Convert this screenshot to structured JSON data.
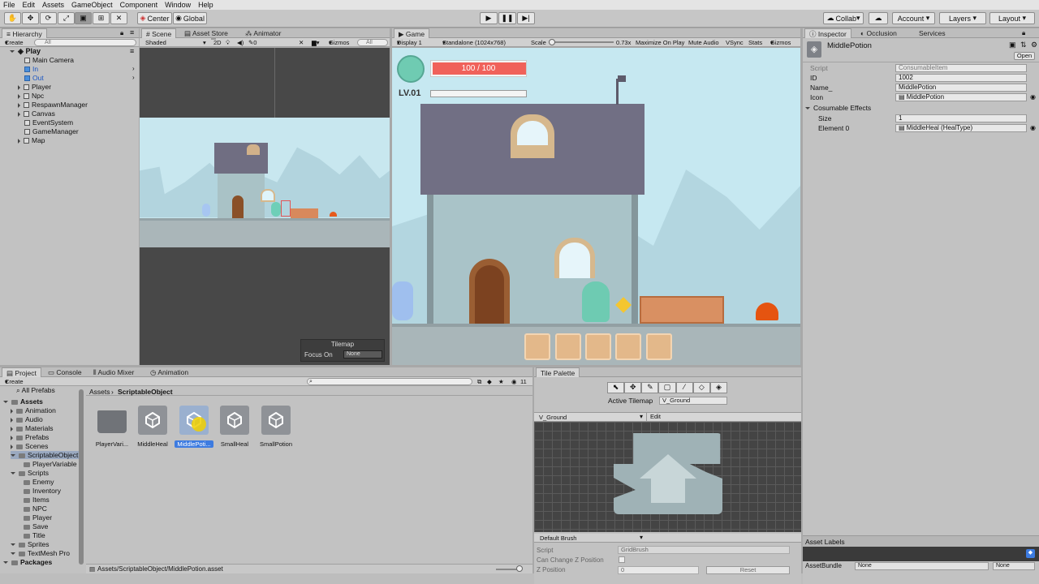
{
  "menu": [
    "File",
    "Edit",
    "Assets",
    "GameObject",
    "Component",
    "Window",
    "Help"
  ],
  "toolbar": {
    "pivot": "Center",
    "space": "Global",
    "collab": "Collab",
    "account": "Account",
    "layers": "Layers",
    "layout": "Layout"
  },
  "hierarchy": {
    "tab": "Hierarchy",
    "create": "Create",
    "search_placeholder": "All",
    "scene": "Play",
    "items": [
      "Main Camera",
      "In",
      "Out",
      "Player",
      "Npc",
      "RespawnManager",
      "Canvas",
      "EventSystem",
      "GameManager",
      "Map"
    ]
  },
  "scene_view": {
    "tabs": [
      "Scene",
      "Asset Store",
      "Animator"
    ],
    "shading": "Shaded",
    "mode_2d": "2D",
    "fx_count": "0",
    "gizmos": "Gizmos",
    "search_placeholder": "All",
    "tilemap_title": "Tilemap",
    "focus_label": "Focus On",
    "focus_value": "None"
  },
  "game_view": {
    "tab": "Game",
    "display": "Display 1",
    "resolution": "Standalone (1024x768)",
    "scale_label": "Scale",
    "scale_value": "0.73x",
    "maximize": "Maximize On Play",
    "mute": "Mute Audio",
    "vsync": "VSync",
    "stats": "Stats",
    "gizmos": "Gizmos",
    "hp_text": "100 / 100",
    "hp_fraction": 1.0,
    "level_text": "LV.01",
    "xp_fraction": 0.0
  },
  "inspector": {
    "tabs": [
      "Inspector",
      "Occlusion",
      "Services"
    ],
    "object_name": "MiddlePotion",
    "open_button": "Open",
    "fields": [
      {
        "label": "Script",
        "value": "ConsumableItem"
      },
      {
        "label": "ID",
        "value": "1002"
      },
      {
        "label": "Name_",
        "value": "MiddlePotion"
      },
      {
        "label": "Icon",
        "value": "MiddlePotion"
      }
    ],
    "section": "Cosumable Effects",
    "size_label": "Size",
    "size_value": "1",
    "element_label": "Element 0",
    "element_value": "MiddleHeal (HealType)",
    "asset_labels": "Asset Labels",
    "assetbundle_label": "AssetBundle",
    "assetbundle_value": "None",
    "assetbundle_variant": "None"
  },
  "project": {
    "tabs": [
      "Project",
      "Console",
      "Audio Mixer",
      "Animation"
    ],
    "create": "Create",
    "favorites": "All Prefabs",
    "tree": [
      {
        "label": "Assets",
        "depth": 0,
        "bold": true
      },
      {
        "label": "Animation",
        "depth": 1
      },
      {
        "label": "Audio",
        "depth": 1
      },
      {
        "label": "Materials",
        "depth": 1
      },
      {
        "label": "Prefabs",
        "depth": 1
      },
      {
        "label": "Scenes",
        "depth": 1
      },
      {
        "label": "ScriptableObject",
        "depth": 1,
        "selected": true
      },
      {
        "label": "PlayerVariable",
        "depth": 2
      },
      {
        "label": "Scripts",
        "depth": 1
      },
      {
        "label": "Enemy",
        "depth": 2
      },
      {
        "label": "Inventory",
        "depth": 2
      },
      {
        "label": "Items",
        "depth": 2
      },
      {
        "label": "NPC",
        "depth": 2
      },
      {
        "label": "Player",
        "depth": 2
      },
      {
        "label": "Save",
        "depth": 2
      },
      {
        "label": "Title",
        "depth": 2
      },
      {
        "label": "Sprites",
        "depth": 1
      },
      {
        "label": "TextMesh Pro",
        "depth": 1
      },
      {
        "label": "Packages",
        "depth": 0,
        "bold": true
      }
    ],
    "breadcrumb_root": "Assets",
    "breadcrumb_current": "ScriptableObject",
    "count": "11",
    "assets": [
      {
        "label": "PlayerVari...",
        "kind": "folder"
      },
      {
        "label": "MiddleHeal",
        "kind": "unity"
      },
      {
        "label": "MiddlePoti...",
        "kind": "unity",
        "selected": true
      },
      {
        "label": "SmallHeal",
        "kind": "unity"
      },
      {
        "label": "SmallPotion",
        "kind": "unity"
      }
    ],
    "path": "Assets/ScriptableObject/MiddlePotion.asset"
  },
  "tile_palette": {
    "tab": "Tile Palette",
    "active_label": "Active Tilemap",
    "active_value": "V_Ground",
    "palette_name": "V_Ground",
    "edit": "Edit",
    "brush": "Default Brush",
    "script_label": "Script",
    "script_value": "GridBrush",
    "zchange_label": "Can Change Z Position",
    "zpos_label": "Z Position",
    "zpos_value": "0",
    "reset": "Reset"
  }
}
